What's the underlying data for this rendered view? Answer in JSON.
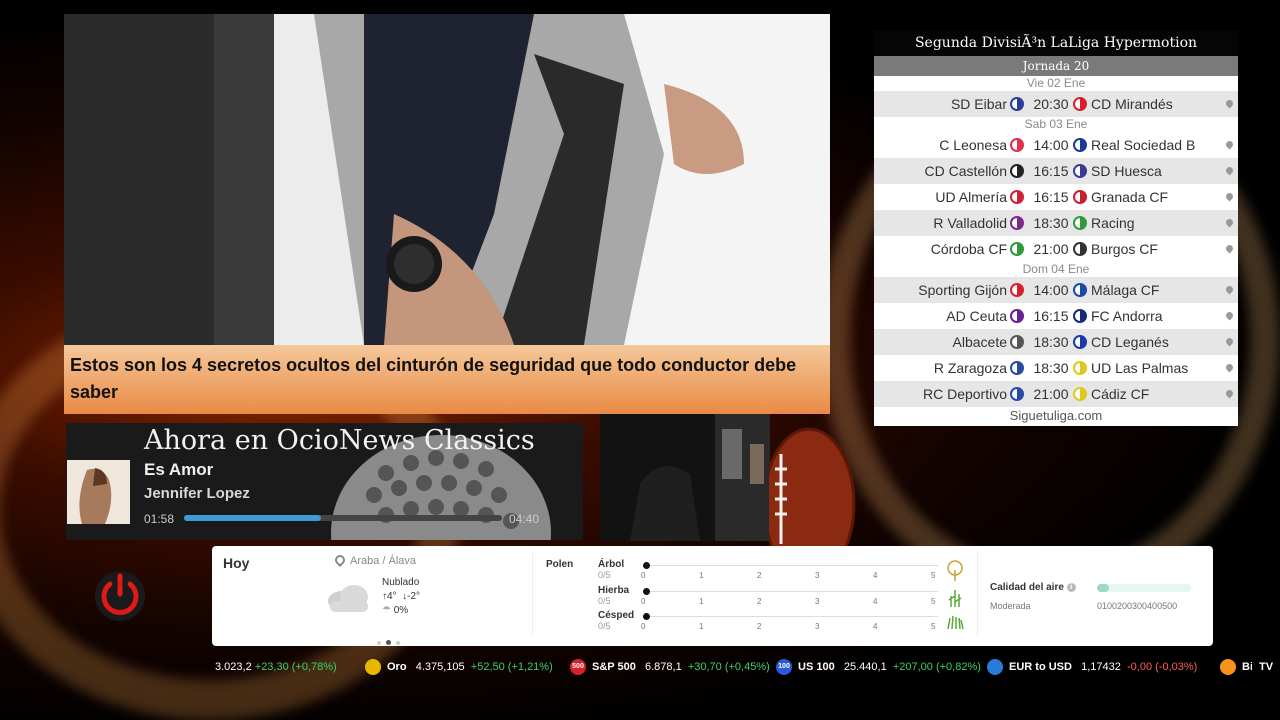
{
  "news": {
    "caption": "Estos son los 4 secretos ocultos del cinturón de seguridad que todo conductor debe saber"
  },
  "music": {
    "header": "Ahora en OcioNews Classics",
    "song": "Es Amor",
    "artist": "Jennifer Lopez",
    "time_elapsed": "01:58",
    "time_total": "04:40",
    "progress": 0.43
  },
  "liga": {
    "title": "Segunda DivisiÃ³n LaLiga Hypermotion",
    "round": "Jornada 20",
    "days": [
      {
        "label": "Vie 02 Ene",
        "matches": [
          {
            "home": "SD Eibar",
            "time": "20:30",
            "away": "CD Mirandés",
            "home_color": "#2a3e9a",
            "away_color": "#d8202a"
          }
        ]
      },
      {
        "label": "Sab 03 Ene",
        "matches": [
          {
            "home": "C Leonesa",
            "time": "14:00",
            "away": "Real Sociedad B",
            "home_color": "#e03050",
            "away_color": "#1a3a9a"
          },
          {
            "home": "CD Castellón",
            "time": "16:15",
            "away": "SD Huesca",
            "home_color": "#222222",
            "away_color": "#3a3a9a"
          },
          {
            "home": "UD Almería",
            "time": "16:15",
            "away": "Granada CF",
            "home_color": "#d0203a",
            "away_color": "#c81e2e"
          },
          {
            "home": "R Valladolid",
            "time": "18:30",
            "away": "Racing",
            "home_color": "#7a2a8a",
            "away_color": "#2e9a3a"
          },
          {
            "home": "Córdoba CF",
            "time": "21:00",
            "away": "Burgos CF",
            "home_color": "#2e9a3a",
            "away_color": "#333333"
          }
        ]
      },
      {
        "label": "Dom 04 Ene",
        "matches": [
          {
            "home": "Sporting Gijón",
            "time": "14:00",
            "away": "Málaga CF",
            "home_color": "#d8202a",
            "away_color": "#1a4aa8"
          },
          {
            "home": "AD Ceuta",
            "time": "16:15",
            "away": "FC Andorra",
            "home_color": "#6a2090",
            "away_color": "#1a2a7a"
          },
          {
            "home": "Albacete",
            "time": "18:30",
            "away": "CD Leganés",
            "home_color": "#555555",
            "away_color": "#1a3aa8"
          },
          {
            "home": "R Zaragoza",
            "time": "18:30",
            "away": "UD Las Palmas",
            "home_color": "#2a4aa8",
            "away_color": "#e0c81a"
          },
          {
            "home": "RC Deportivo",
            "time": "21:00",
            "away": "Cádiz CF",
            "home_color": "#2a4aa8",
            "away_color": "#e0c81a"
          }
        ]
      }
    ],
    "footer": "Siguetuliga.com"
  },
  "weather": {
    "day": "Hoy",
    "location": "Araba / Álava",
    "condition": "Nublado",
    "temp_max": "4°",
    "temp_min": "-2°",
    "precip": "0%",
    "pollen_title": "Polen",
    "pollen": [
      {
        "name": "Árbol",
        "value": "0/5",
        "level": 0
      },
      {
        "name": "Hierba",
        "value": "0/5",
        "level": 0
      },
      {
        "name": "Césped",
        "value": "0/5",
        "level": 0
      }
    ],
    "pollen_scale": [
      "0",
      "1",
      "2",
      "3",
      "4",
      "5"
    ],
    "air_title": "Calidad del aire",
    "air_status": "Moderada",
    "air_scale": "0100200300400500",
    "air_level": 0.05
  },
  "ticker": [
    {
      "name": "",
      "price": "3.023,2",
      "change": "+23,30 (+0,78%)",
      "dir": "up",
      "icon": ""
    },
    {
      "name": "Oro",
      "price": "4.375,105",
      "change": "+52,50 (+1,21%)",
      "dir": "up",
      "icon": "gold-icon",
      "icon_text": "",
      "color": "#e8b800"
    },
    {
      "name": "S&P 500",
      "price": "6.878,1",
      "change": "+30,70 (+0,45%)",
      "dir": "up",
      "icon": "sp500-icon",
      "icon_text": "500",
      "color": "#d8202a"
    },
    {
      "name": "US 100",
      "price": "25.440,1",
      "change": "+207,00 (+0,82%)",
      "dir": "up",
      "icon": "us100-icon",
      "icon_text": "100",
      "color": "#2a5ad8"
    },
    {
      "name": "EUR to USD",
      "price": "1,17432",
      "change": "-0,00 (-0,03%)",
      "dir": "down",
      "icon": "eurusd-icon",
      "icon_text": "",
      "color": "#2a7ad8"
    },
    {
      "name": "Bitc",
      "price": "",
      "change": "",
      "dir": "up",
      "icon": "bitcoin-icon",
      "icon_text": "",
      "color": "#f7931a"
    }
  ],
  "ticker_brand": "TV"
}
